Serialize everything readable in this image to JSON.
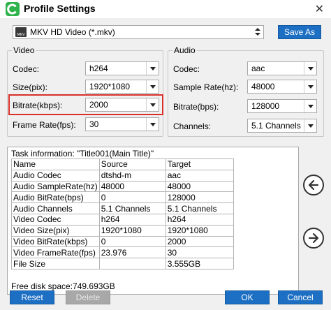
{
  "window": {
    "title": "Profile Settings",
    "close_glyph": "✕"
  },
  "profile": {
    "selected": "MKV HD Video (*.mkv)",
    "save_as_label": "Save As"
  },
  "video": {
    "group_label": "Video",
    "codec_label": "Codec:",
    "codec_value": "h264",
    "size_label": "Size(pix):",
    "size_value": "1920*1080",
    "bitrate_label": "Bitrate(kbps):",
    "bitrate_value": "2000",
    "framerate_label": "Frame Rate(fps):",
    "framerate_value": "30"
  },
  "audio": {
    "group_label": "Audio",
    "codec_label": "Codec:",
    "codec_value": "aac",
    "samplerate_label": "Sample Rate(hz):",
    "samplerate_value": "48000",
    "bitrate_label": "Bitrate(bps):",
    "bitrate_value": "128000",
    "channels_label": "Channels:",
    "channels_value": "5.1 Channels"
  },
  "task_info": {
    "title": "Task information: \"Title001(Main Title)\"",
    "headers": [
      "Name",
      "Source",
      "Target"
    ],
    "rows": [
      [
        "Audio Codec",
        "dtshd-m",
        "aac"
      ],
      [
        "Audio SampleRate(hz)",
        "48000",
        "48000"
      ],
      [
        "Audio BitRate(bps)",
        "0",
        "128000"
      ],
      [
        "Audio Channels",
        "5.1 Channels",
        "5.1 Channels"
      ],
      [
        "Video Codec",
        "h264",
        "h264"
      ],
      [
        "Video Size(pix)",
        "1920*1080",
        "1920*1080"
      ],
      [
        "Video BitRate(kbps)",
        "0",
        "2000"
      ],
      [
        "Video FrameRate(fps)",
        "23.976",
        "30"
      ],
      [
        "File Size",
        "",
        "3.555GB"
      ]
    ],
    "free_disk": "Free disk space:749.693GB"
  },
  "buttons": {
    "reset": "Reset",
    "delete": "Delete",
    "ok": "OK",
    "cancel": "Cancel"
  },
  "colors": {
    "accent": "#1d6fc4",
    "highlight": "#d9302c",
    "app_icon": "#2db34a"
  },
  "icons": [
    "app-logo-icon",
    "close-icon",
    "mkv-file-icon",
    "dropdown-arrow-icon",
    "arrow-left-icon",
    "arrow-right-icon"
  ]
}
